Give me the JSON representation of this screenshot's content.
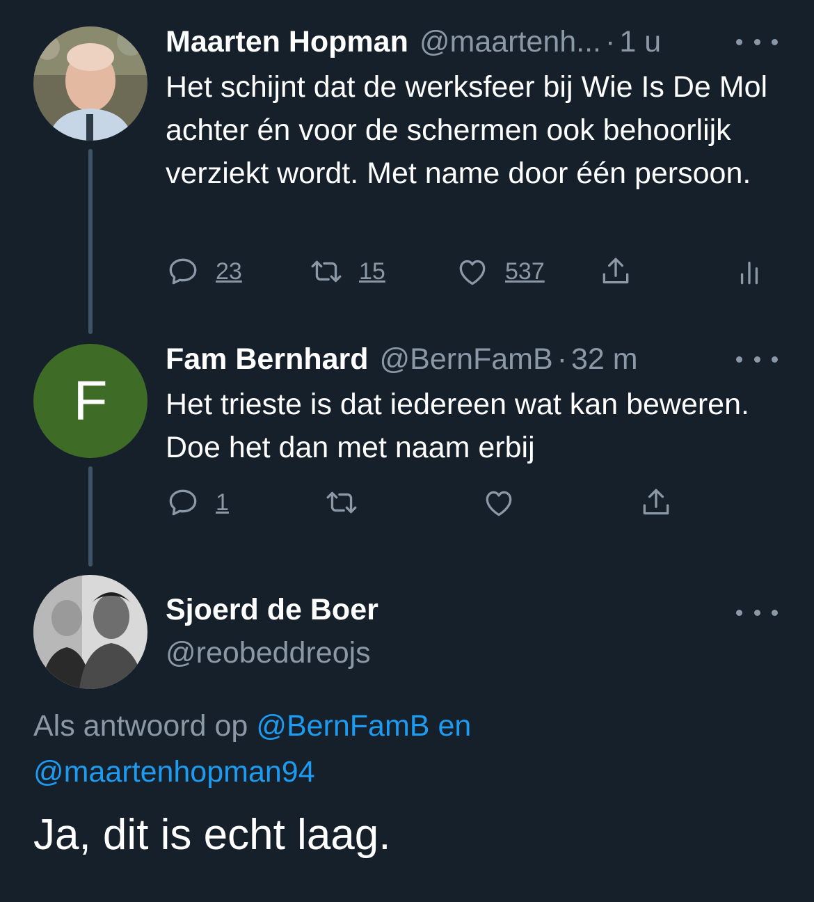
{
  "tweets": [
    {
      "name": "Maarten Hopman",
      "handle": "@maartenh...",
      "time": "1 u",
      "text": "Het schijnt dat de werksfeer bij Wie Is De Mol achter én voor de schermen ook behoorlijk verziekt wordt. Met name door één persoon.",
      "replies": "23",
      "retweets": "15",
      "likes": "537"
    },
    {
      "name": "Fam Bernhard",
      "handle": "@BernFamB",
      "time": "32 m",
      "avatar_letter": "F",
      "text": "Het trieste is dat iedereen wat kan beweren. Doe het dan met naam erbij",
      "replies": "1"
    }
  ],
  "main_tweet": {
    "name": "Sjoerd de Boer",
    "handle": "@reobeddreojs",
    "reply_prefix": "Als antwoord op",
    "mention_1": "@BernFamB",
    "reply_joiner": "en",
    "mention_2": "@maartenhopman94",
    "text": "Ja, dit is echt laag."
  },
  "dot_separator": "·",
  "colors": {
    "background": "#15202b",
    "muted": "#8b98a5",
    "link": "#1d9bf0",
    "thread_line": "#3d5466",
    "avatar_f_bg": "#3e6b25"
  },
  "icons": [
    "reply-icon",
    "retweet-icon",
    "like-icon",
    "share-icon",
    "analytics-icon",
    "more-icon"
  ]
}
